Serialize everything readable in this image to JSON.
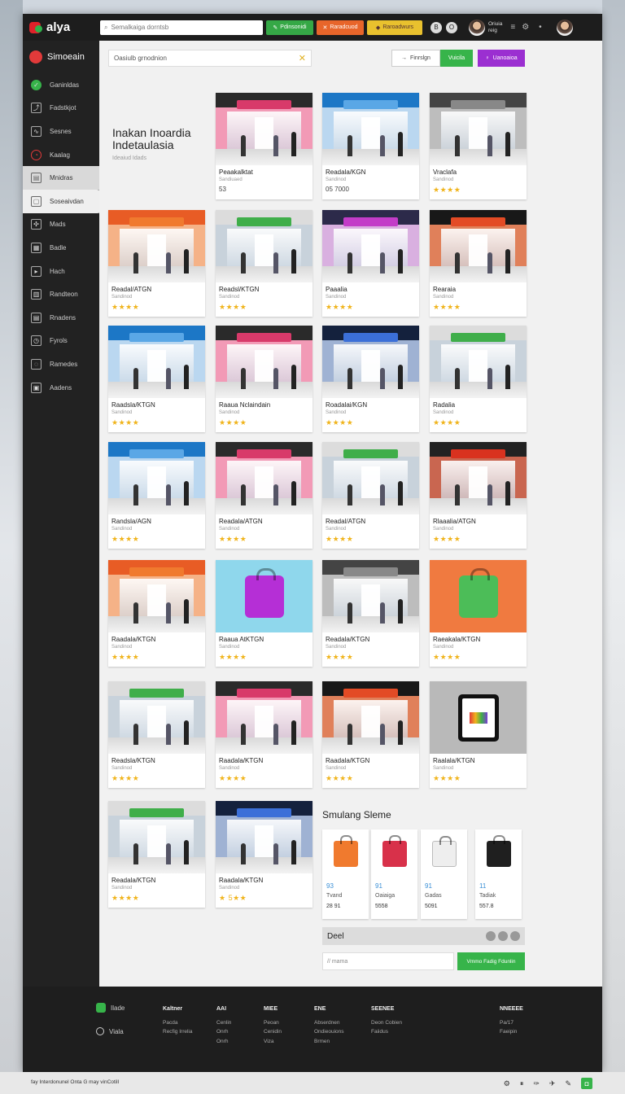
{
  "app": {
    "name": "alya"
  },
  "topbar": {
    "search_placeholder": "Sеmalkaiga dorntsb",
    "btn1": "Pdinsonidi",
    "btn2": "Raradcuod",
    "btn3": "Raroadwurs",
    "circle1": "B",
    "circle2": "O",
    "profile_line1": "Oriuia",
    "profile_line2": "reig"
  },
  "sidebar": {
    "header": "Simoeain",
    "items": [
      {
        "label": "Ganinldas",
        "icon": "✓"
      },
      {
        "label": "Fadstkjot",
        "icon": "⤴"
      },
      {
        "label": "Sesnes",
        "icon": "∿"
      },
      {
        "label": "Kaalag",
        "icon": "◔"
      },
      {
        "label": "Mnidras",
        "icon": "▤"
      },
      {
        "label": "Soseaivdan",
        "icon": "▢"
      },
      {
        "label": "Mads",
        "icon": "✣"
      },
      {
        "label": "Badle",
        "icon": "▦"
      },
      {
        "label": "Hach",
        "icon": "▸"
      },
      {
        "label": "Randteon",
        "icon": "▥"
      },
      {
        "label": "Rnadens",
        "icon": "▤"
      },
      {
        "label": "Fyrols",
        "icon": "◷"
      },
      {
        "label": "Ramedes",
        "icon": "◌"
      },
      {
        "label": "Aadens",
        "icon": "▣"
      }
    ]
  },
  "main": {
    "filter_placeholder": "Oasiulb grnodnion",
    "seg_btn1": "Finrslgn",
    "seg_btn2": "Vuicila",
    "seg_btn3": "Uanoaioa",
    "hero_title_1": "Inakan Inoardia",
    "hero_title_2": "Indetaulasia",
    "hero_sub": "Ideaiud Idads",
    "cards": [
      {
        "name": "Peaakalktat",
        "meta": "Sandiuaed",
        "price": "53",
        "theme": "pink"
      },
      {
        "name": "Readala/KGN",
        "meta": "Sandinod",
        "price": "05 7000",
        "theme": "blue"
      },
      {
        "name": "Vraclafa",
        "meta": "Sandinod",
        "stars": "★★★★",
        "theme": "grey"
      },
      {
        "name": "Readal/ATGN",
        "meta": "Sandinod",
        "stars": "★★★★",
        "theme": "orange"
      },
      {
        "name": "Readsl/KTGN",
        "meta": "Sandinod",
        "stars": "★★★★",
        "theme": "mall"
      },
      {
        "name": "Paaalia",
        "meta": "Sandinod",
        "stars": "★★★★",
        "theme": "violet"
      },
      {
        "name": "Rearaia",
        "meta": "Sandinod",
        "stars": "★★★★",
        "theme": "orangeDark"
      },
      {
        "name": "Raadsla/KTGN",
        "meta": "Sandinod",
        "stars": "★★★★",
        "theme": "blue"
      },
      {
        "name": "Raaua Nclaindain",
        "meta": "Sandinod",
        "stars": "★★★★",
        "theme": "pink"
      },
      {
        "name": "Roadalai/KGN",
        "meta": "Sandinod",
        "stars": "★★★★",
        "theme": "navy"
      },
      {
        "name": "Radalia",
        "meta": "Sandinod",
        "stars": "★★★★",
        "theme": "mall"
      },
      {
        "name": "Randsla/AGN",
        "meta": "Sandinod",
        "stars": "★★★★",
        "theme": "blue"
      },
      {
        "name": "Readala/ATGN",
        "meta": "Sandinod",
        "stars": "★★★★",
        "theme": "pink"
      },
      {
        "name": "Readal/ATGN",
        "meta": "Sandinod",
        "stars": "★★★★",
        "theme": "mall"
      },
      {
        "name": "Rlaaalia/ATGN",
        "meta": "Sandinod",
        "stars": "★★★★",
        "theme": "redDark"
      },
      {
        "name": "Raadala/KTGN",
        "meta": "Sandinod",
        "stars": "★★★★",
        "theme": "orange"
      },
      {
        "name": "Raaua AtKTGN",
        "meta": "Sandinod",
        "stars": "★★★★",
        "theme": "product-purple"
      },
      {
        "name": "Readala/KTGN",
        "meta": "Sandinod",
        "stars": "★★★★",
        "theme": "grey"
      },
      {
        "name": "Raeakala/KTGN",
        "meta": "Sandinod",
        "stars": "★★★★",
        "theme": "product-orange"
      },
      {
        "name": "Readsla/KTGN",
        "meta": "Sandinod",
        "stars": "★★★★",
        "theme": "mall"
      },
      {
        "name": "Raadala/KTGN",
        "meta": "Sandinod",
        "stars": "★★★★",
        "theme": "pink"
      },
      {
        "name": "Raadala/KTGN",
        "meta": "Sandinod",
        "stars": "★★★★",
        "theme": "orangeDark"
      },
      {
        "name": "Raalala/KTGN",
        "meta": "Sandinod",
        "stars": "★★★★",
        "theme": "product-tablet"
      },
      {
        "name": "Readala/KTGN",
        "meta": "Sandinod",
        "stars": "★★★★",
        "theme": "mall"
      },
      {
        "name": "Raadala/KTGN",
        "meta": "Sandinod",
        "stars": "★ 5★★",
        "theme": "navy"
      }
    ],
    "similar_title": "Smulang Sleme",
    "similar": [
      {
        "num": "93",
        "name": "Tvand",
        "price": "28 91",
        "color": "#f07a2e"
      },
      {
        "num": "91",
        "name": "Oaiaiga",
        "price": "5558",
        "color": "#d8314a"
      },
      {
        "num": "91",
        "name": "Gadas",
        "price": "5091",
        "color": "#eeeeee"
      },
      {
        "num": "11",
        "name": "Tadiak",
        "price": "557.8",
        "color": "#1f1f1f"
      }
    ],
    "deal_label": "Deel",
    "comment_placeholder": "// mama",
    "comment_btn": "Vmmo Fadig Fdunlin"
  },
  "footer": {
    "brand1": "Ilade",
    "brand2": "Viala",
    "cols": [
      {
        "h": "Kaltner",
        "a": "Pacda",
        "b": "Recfig Irrelia",
        "c": ""
      },
      {
        "h": "AAI",
        "a": "Cenlin",
        "b": "Onrh",
        "c": "Onrh"
      },
      {
        "h": "MIEE",
        "a": "Peoan",
        "b": "Cenidin",
        "c": "Viza"
      },
      {
        "h": "ENE",
        "a": "Abserdnen",
        "b": "Ondieouions",
        "c": "Brmen"
      },
      {
        "h": "SEENEE",
        "a": "Deon Cobien",
        "b": "Faiidus",
        "c": ""
      },
      {
        "h": "NNEEEE",
        "a": "Pa/17",
        "b": "Faeipin",
        "c": ""
      }
    ]
  },
  "bottom": {
    "text": "fay Interdonunel Onta G may vinCotill"
  }
}
